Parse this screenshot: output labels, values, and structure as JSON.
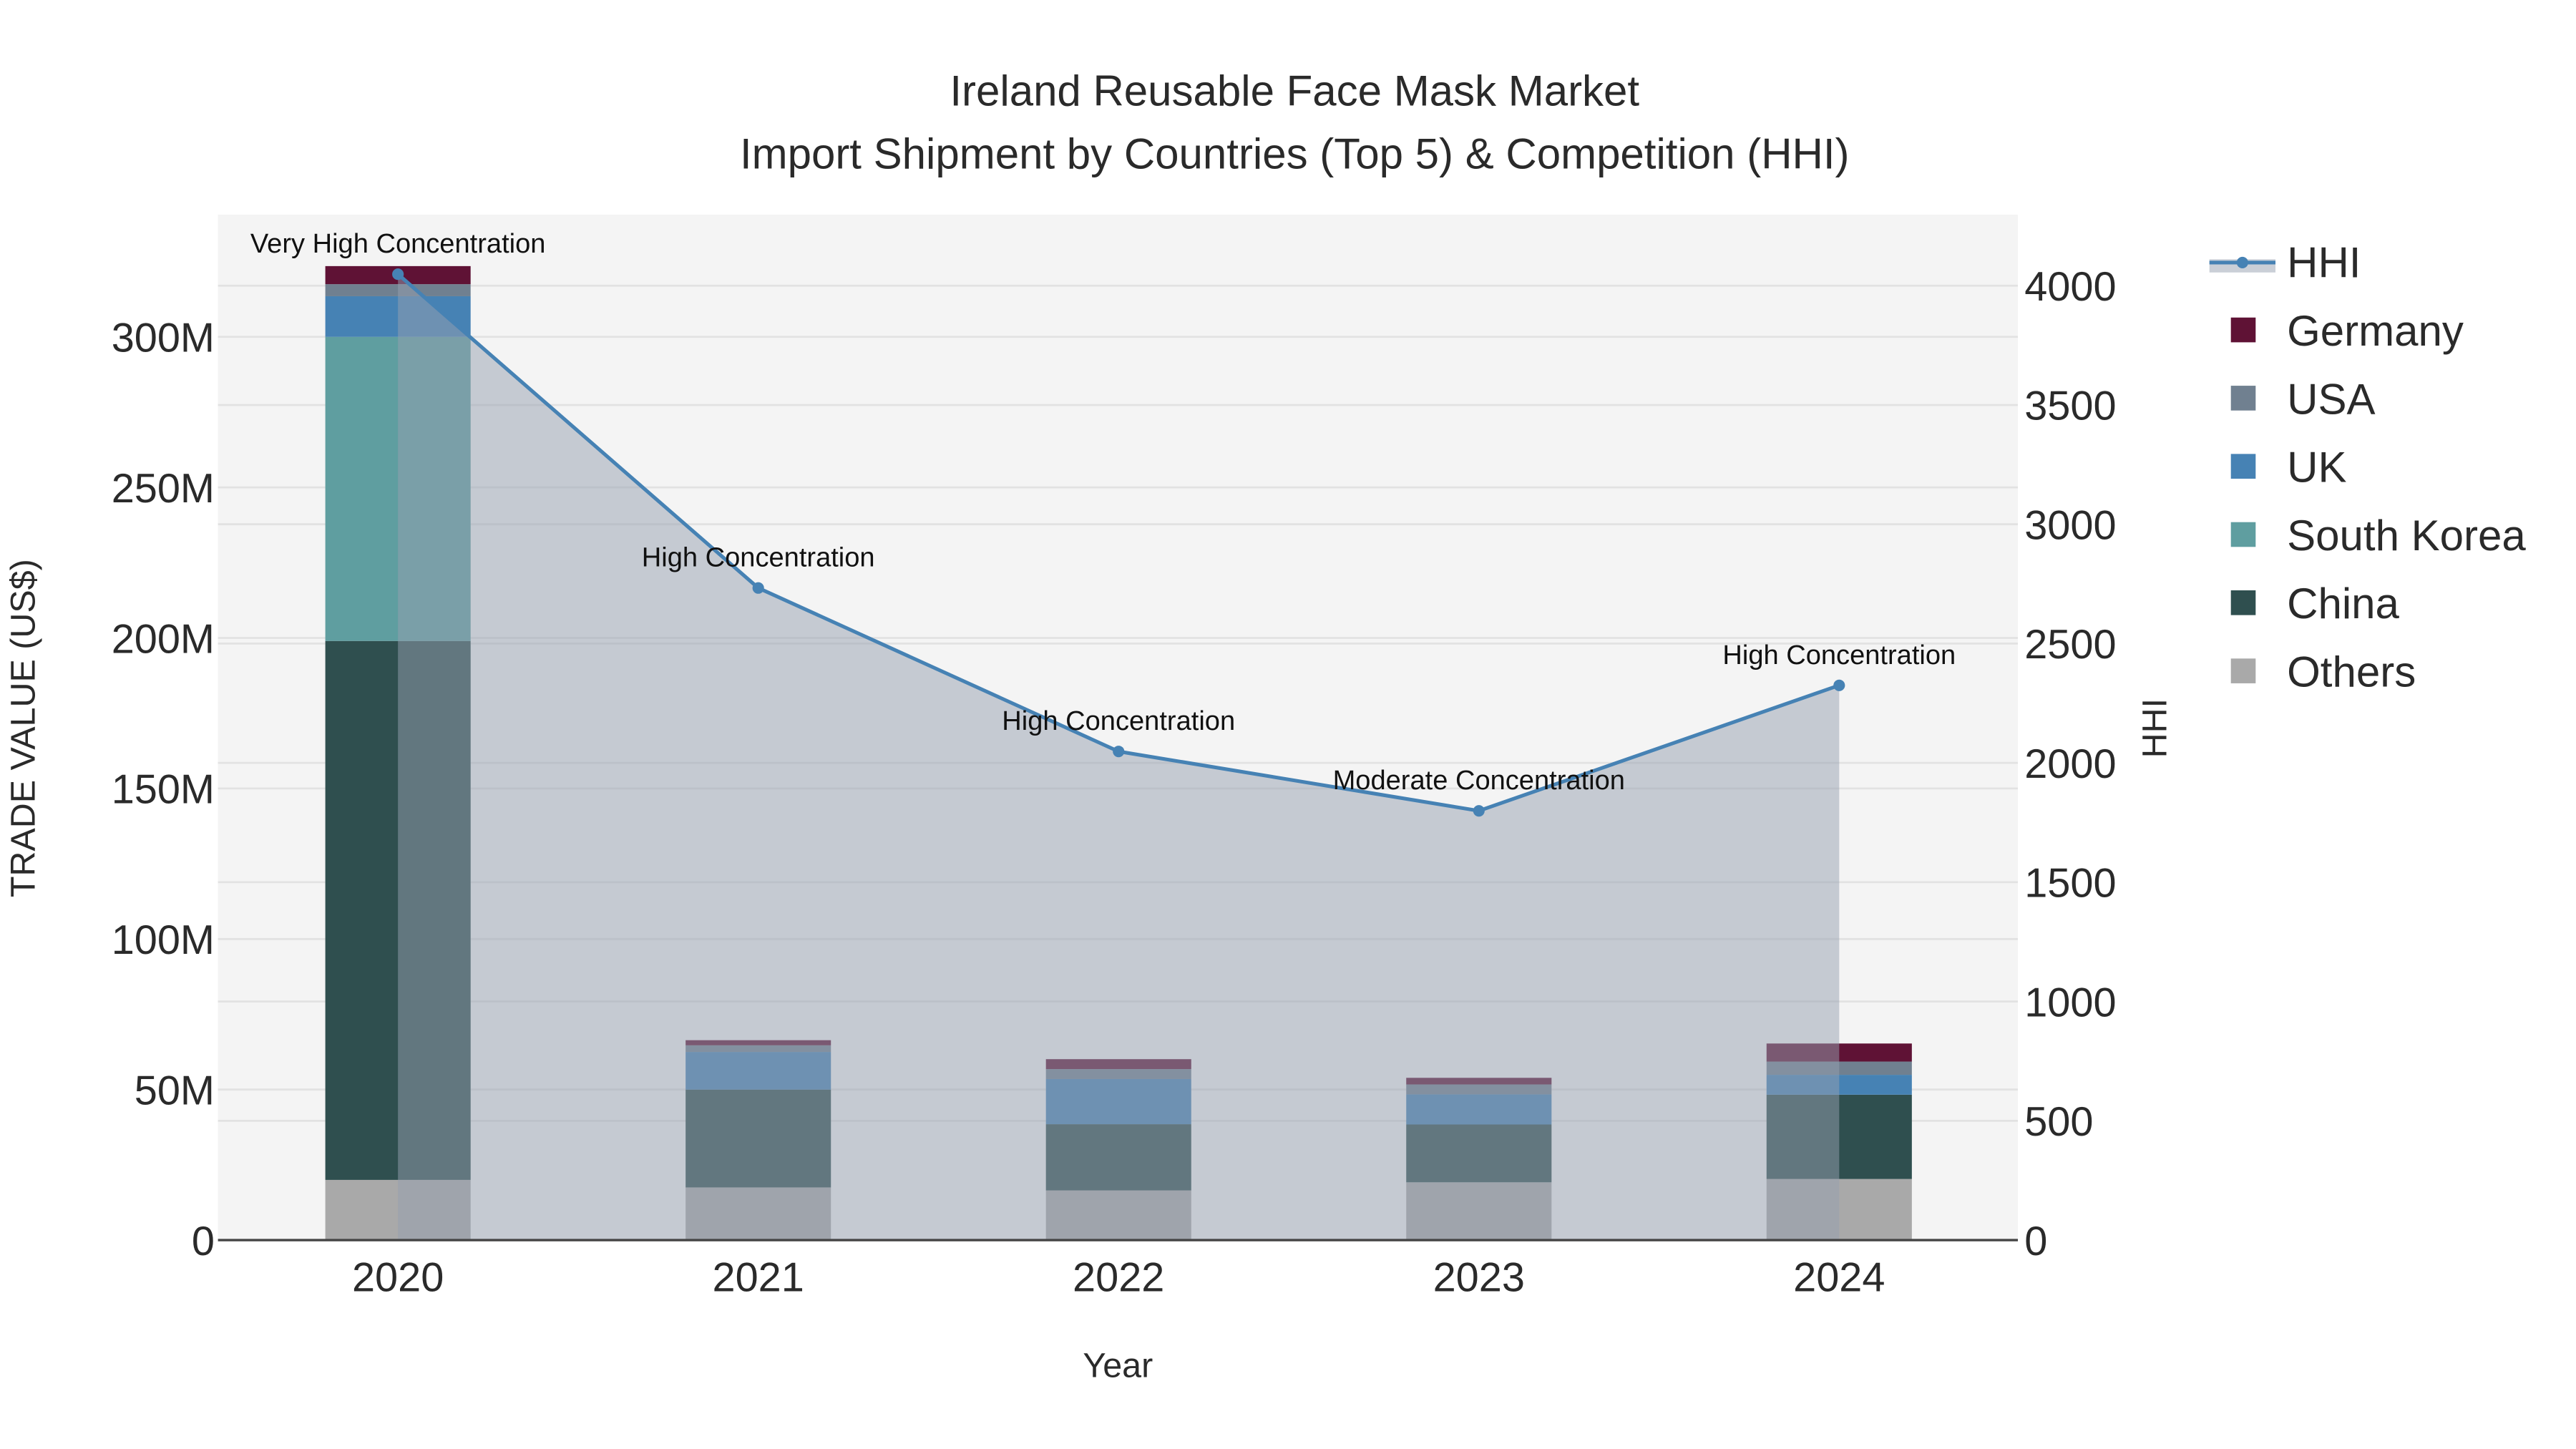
{
  "chart_data": {
    "type": "bar",
    "stacked": true,
    "title": "Ireland Reusable Face Mask Market",
    "subtitle": "Import Shipment by Countries (Top 5) & Competition (HHI)",
    "xlabel": "Year",
    "ylabel": "TRADE VALUE (US$)",
    "y2label": "HHI",
    "categories": [
      "2020",
      "2021",
      "2022",
      "2023",
      "2024"
    ],
    "ylim": [
      0,
      330
    ],
    "y_unit": "M",
    "y_ticks": [
      0,
      50,
      100,
      150,
      200,
      250,
      300
    ],
    "y_tick_labels": [
      "0",
      "50M",
      "100M",
      "150M",
      "200M",
      "250M",
      "300M"
    ],
    "y2lim": [
      0,
      4300
    ],
    "y2_ticks": [
      0,
      500,
      1000,
      1500,
      2000,
      2500,
      3000,
      3500,
      4000
    ],
    "y2_tick_labels": [
      "0",
      "500",
      "1000",
      "1500",
      "2000",
      "2500",
      "3000",
      "3500",
      "4000"
    ],
    "series": [
      {
        "name": "Others",
        "color": "#a9a9a9",
        "values": [
          20,
          17.5,
          16.5,
          19.2,
          20.3
        ]
      },
      {
        "name": "China",
        "color": "#2f4f4f",
        "values": [
          179,
          32.5,
          22,
          19.2,
          28
        ]
      },
      {
        "name": "South Korea",
        "color": "#5f9ea0",
        "values": [
          101,
          0,
          0,
          0,
          0
        ]
      },
      {
        "name": "UK",
        "color": "#4682b4",
        "values": [
          13.5,
          12.5,
          15,
          10,
          6.6
        ]
      },
      {
        "name": "USA",
        "color": "#708090",
        "values": [
          4,
          2.2,
          3.3,
          3.3,
          4.4
        ]
      },
      {
        "name": "Germany",
        "color": "#5f1235",
        "values": [
          6,
          1.7,
          3.3,
          2.2,
          6
        ]
      }
    ],
    "line": {
      "name": "HHI",
      "axis": "right",
      "color": "#4682b4",
      "values": [
        4048,
        2733,
        2048,
        1799,
        2325
      ],
      "annotations": [
        "Very High Concentration",
        "High Concentration",
        "High Concentration",
        "Moderate Concentration",
        "High Concentration"
      ]
    },
    "legend": {
      "placement": "right",
      "entries": [
        "HHI",
        "Germany",
        "USA",
        "UK",
        "South Korea",
        "China",
        "Others"
      ]
    },
    "grid": true
  }
}
